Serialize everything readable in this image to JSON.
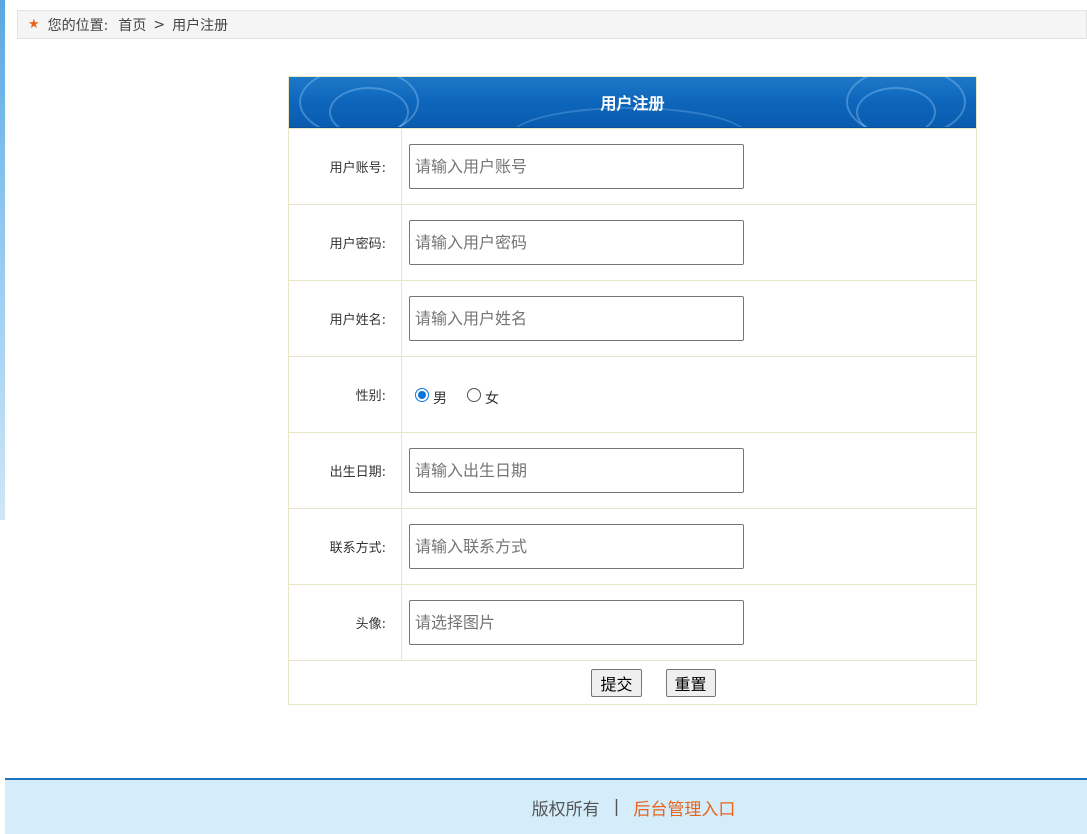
{
  "breadcrumb": {
    "prefix": "您的位置:",
    "home": "首页",
    "separator": ">",
    "current": "用户注册",
    "icon": "star-icon"
  },
  "form": {
    "title": "用户注册",
    "fields": [
      {
        "label": "用户账号:",
        "placeholder": "请输入用户账号",
        "value": ""
      },
      {
        "label": "用户密码:",
        "placeholder": "请输入用户密码",
        "value": ""
      },
      {
        "label": "用户姓名:",
        "placeholder": "请输入用户姓名",
        "value": ""
      }
    ],
    "gender": {
      "label": "性别:",
      "options": [
        {
          "label": "男",
          "checked": true
        },
        {
          "label": "女",
          "checked": false
        }
      ]
    },
    "fields2": [
      {
        "label": "出生日期:",
        "placeholder": "请输入出生日期",
        "value": ""
      },
      {
        "label": "联系方式:",
        "placeholder": "请输入联系方式",
        "value": ""
      },
      {
        "label": "头像:",
        "placeholder": "请选择图片",
        "value": ""
      }
    ],
    "submit_label": "提交",
    "reset_label": "重置"
  },
  "footer": {
    "copyright": "版权所有",
    "divider": "|",
    "admin_link": "后台管理入口"
  },
  "colors": {
    "accent": "#0d66bb",
    "link_orange": "#e8641b",
    "footer_bg": "#d5edfa"
  }
}
